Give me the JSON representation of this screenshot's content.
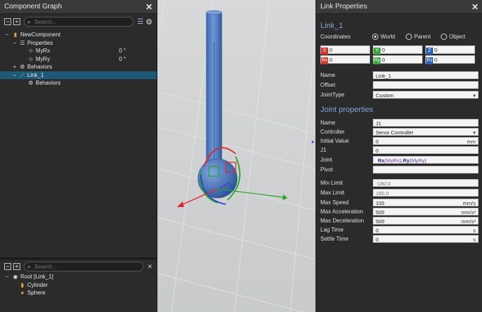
{
  "left_panel": {
    "title": "Component Graph",
    "search_placeholder": "Search...",
    "tree": [
      {
        "label": "NewComponent",
        "value": ""
      },
      {
        "label": "Properties",
        "value": ""
      },
      {
        "label": "MyRx",
        "value": "0 °"
      },
      {
        "label": "MyRy",
        "value": "0 °"
      },
      {
        "label": "Behaviors",
        "value": ""
      },
      {
        "label": "Link_1",
        "value": ""
      },
      {
        "label": "Behaviors",
        "value": ""
      }
    ],
    "bottom_search_placeholder": "Search...",
    "bottom_tree": [
      {
        "label": "Root [Link_1]"
      },
      {
        "label": "Cylinder"
      },
      {
        "label": "Sphere"
      }
    ]
  },
  "right_panel": {
    "title": "Link Properties",
    "link_name": "Link_1",
    "coordinates_label": "Coordinates",
    "radios": [
      "World",
      "Parent",
      "Object"
    ],
    "coords": [
      {
        "tag": "X",
        "value": "0",
        "color": "#d9342b"
      },
      {
        "tag": "Y",
        "value": "0",
        "color": "#3aa53a"
      },
      {
        "tag": "Z",
        "value": "0",
        "color": "#2c5fb8"
      },
      {
        "tag": "Rx",
        "value": "0",
        "color": "#d9342b"
      },
      {
        "tag": "Ry",
        "value": "0",
        "color": "#3aa53a"
      },
      {
        "tag": "Rz",
        "value": "0",
        "color": "#2c5fb8"
      }
    ],
    "name_label": "Name",
    "name_value": "Link_1",
    "offset_label": "Offset",
    "offset_value": "",
    "jointtype_label": "JointType",
    "jointtype_value": "Custom",
    "joint_section": "Joint properties",
    "j_name_label": "Name",
    "j_name_value": "J1",
    "controller_label": "Controller",
    "controller_value": "Servo Controller",
    "initial_label": "Initial Value",
    "initial_value": "0",
    "initial_unit": "mm",
    "j1_label": "J1",
    "j1_value": "0",
    "joint_label": "Joint",
    "joint_expr": {
      "rx": "Rx",
      "rx_arg": "(MyRx)",
      "dot": ".",
      "ry": "Ry",
      "ry_arg": "(MyRy)"
    },
    "pivot_label": "Pivot",
    "pivot_value": "",
    "minlimit_label": "Min Limit",
    "minlimit_value": "-180.0",
    "maxlimit_label": "Max Limit",
    "maxlimit_value": "180.0",
    "maxspeed_label": "Max Speed",
    "maxspeed_value": "100",
    "maxspeed_unit": "mm/s",
    "maxacc_label": "Max Acceleration",
    "maxacc_value": "500",
    "maxacc_unit": "mm/s²",
    "maxdec_label": "Max Deceleration",
    "maxdec_value": "500",
    "maxdec_unit": "mm/s²",
    "lag_label": "Lag Time",
    "lag_value": "0",
    "lag_unit": "s",
    "settle_label": "Settle Time",
    "settle_value": "0",
    "settle_unit": "s"
  }
}
